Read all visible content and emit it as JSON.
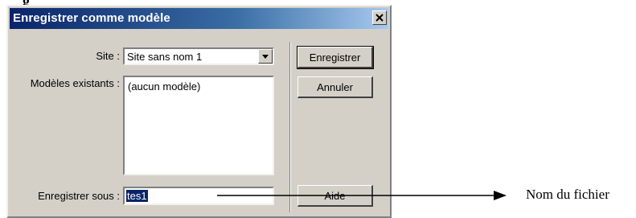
{
  "dialog": {
    "title": "Enregistrer comme modèle",
    "close_icon": "close-icon"
  },
  "form": {
    "site_label": "Site :",
    "site_value": "Site sans nom 1",
    "existing_label": "Modèles existants :",
    "existing_items": [
      "(aucun modèle)"
    ],
    "save_as_label": "Enregistrer sous :",
    "save_as_value": "tes1"
  },
  "buttons": {
    "save": "Enregistrer",
    "cancel": "Annuler",
    "help": "Aide"
  },
  "annotation": {
    "label": "Nom du fichier"
  },
  "colors": {
    "titlebar": "#0a246a",
    "dialog_face": "#d4d0c8",
    "selection": "#0a246a"
  }
}
